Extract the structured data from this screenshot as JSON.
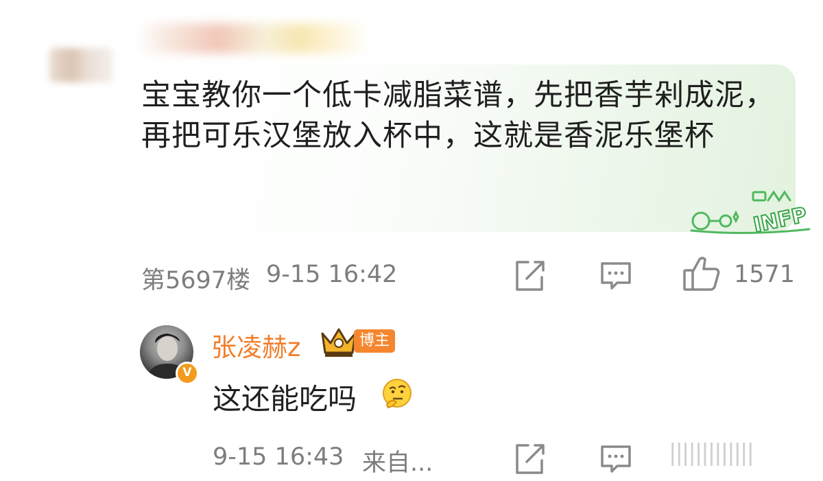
{
  "comment": {
    "text": "宝宝教你一个低卡减脂菜谱，先把香芋剁成泥，再把可乐汉堡放入杯中，这就是香泥乐堡杯",
    "decoration_label": "INFP",
    "floor": "第5697楼",
    "time": "9-15 16:42",
    "likes": "1571"
  },
  "reply": {
    "author": "张凌赫z",
    "role_badge": "博主",
    "verified_badge": "V",
    "text": "这还能吃吗",
    "time": "9-15 16:43",
    "source": "来自..."
  },
  "icons": {
    "share": "share-icon",
    "comment": "comment-icon",
    "like": "thumbs-up-icon",
    "emoji": "thinking-face-emoji"
  },
  "colors": {
    "name_orange": "#f17e2b",
    "meta_gray": "#7d7d7d",
    "bubble_green": "#e3f2df",
    "badge_orange": "#f6862e"
  }
}
